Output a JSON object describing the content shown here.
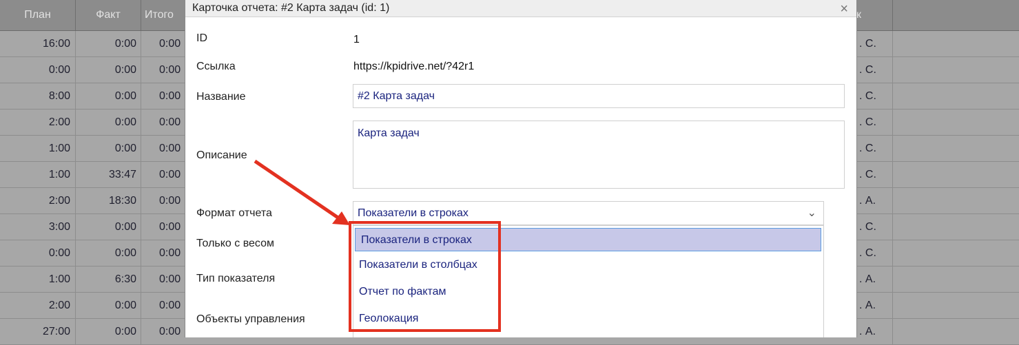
{
  "table": {
    "headers": {
      "plan": "План",
      "fact": "Факт",
      "total": "Итого",
      "right": "к"
    },
    "rows": [
      {
        "plan": "16:00",
        "fact": "0:00",
        "total": "0:00",
        "right": ". С."
      },
      {
        "plan": "0:00",
        "fact": "0:00",
        "total": "0:00",
        "right": ". С."
      },
      {
        "plan": "8:00",
        "fact": "0:00",
        "total": "0:00",
        "right": ". С."
      },
      {
        "plan": "2:00",
        "fact": "0:00",
        "total": "0:00",
        "right": ". С."
      },
      {
        "plan": "1:00",
        "fact": "0:00",
        "total": "0:00",
        "right": ". С."
      },
      {
        "plan": "1:00",
        "fact": "33:47",
        "total": "0:00",
        "right": ". С."
      },
      {
        "plan": "2:00",
        "fact": "18:30",
        "total": "0:00",
        "right": ". А."
      },
      {
        "plan": "3:00",
        "fact": "0:00",
        "total": "0:00",
        "right": ". С."
      },
      {
        "plan": "0:00",
        "fact": "0:00",
        "total": "0:00",
        "right": ". С."
      },
      {
        "plan": "1:00",
        "fact": "6:30",
        "total": "0:00",
        "right": ". А."
      },
      {
        "plan": "2:00",
        "fact": "0:00",
        "total": "0:00",
        "right": ". А."
      },
      {
        "plan": "27:00",
        "fact": "0:00",
        "total": "0:00",
        "right": ". А."
      }
    ]
  },
  "modal": {
    "title": "Карточка отчета: #2 Карта задач (id: 1)",
    "close_glyph": "×",
    "fields": {
      "id_label": "ID",
      "id_value": "1",
      "link_label": "Ссылка",
      "link_value": "https://kpidrive.net/?42r1",
      "name_label": "Название",
      "name_value": "#2 Карта задач",
      "desc_label": "Описание",
      "desc_value": "Карта задач",
      "format_label": "Формат отчета",
      "format_value": "Показатели в строках",
      "weight_label": "Только с весом",
      "type_label": "Тип показателя",
      "objects_label": "Объекты управления"
    },
    "dropdown_options": [
      "Показатели в строках",
      "Показатели в столбцах",
      "Отчет по фактам",
      "Геолокация"
    ]
  },
  "colors": {
    "annotation": "#e33120",
    "option_selected_bg": "#c7c8e8",
    "field_text": "#1a237e"
  },
  "icons": {
    "close": "close-icon",
    "chevron": "chevron-down-icon"
  }
}
